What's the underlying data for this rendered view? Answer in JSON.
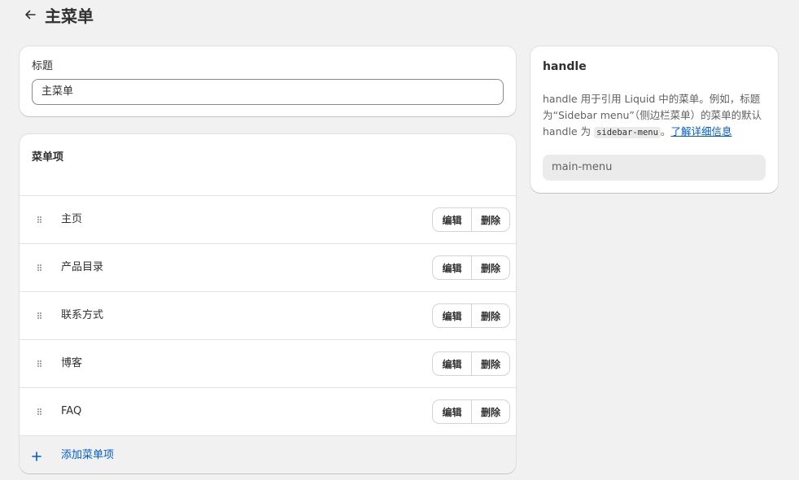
{
  "header": {
    "title": "主菜单",
    "back_icon": "arrow-left-icon"
  },
  "title_card": {
    "label": "标题",
    "value": "主菜单"
  },
  "menu_card": {
    "heading": "菜单项",
    "items": [
      {
        "label": "主页"
      },
      {
        "label": "产品目录"
      },
      {
        "label": "联系方式"
      },
      {
        "label": "博客"
      },
      {
        "label": "FAQ"
      }
    ],
    "edit_label": "编辑",
    "delete_label": "删除",
    "add_label": "添加菜单项"
  },
  "handle_card": {
    "heading": "handle",
    "desc_part1": "handle 用于引用 Liquid 中的菜单。例如，标题为“Sidebar menu”（侧边栏菜单）的菜单的默认 handle 为 ",
    "desc_code": "sidebar-menu",
    "desc_part2": "。",
    "learn_more": "了解详细信息",
    "value": "main-menu"
  },
  "colors": {
    "background": "#f1f1f1",
    "card": "#ffffff",
    "link": "#005bd3",
    "text": "#303030",
    "muted": "#616161"
  }
}
